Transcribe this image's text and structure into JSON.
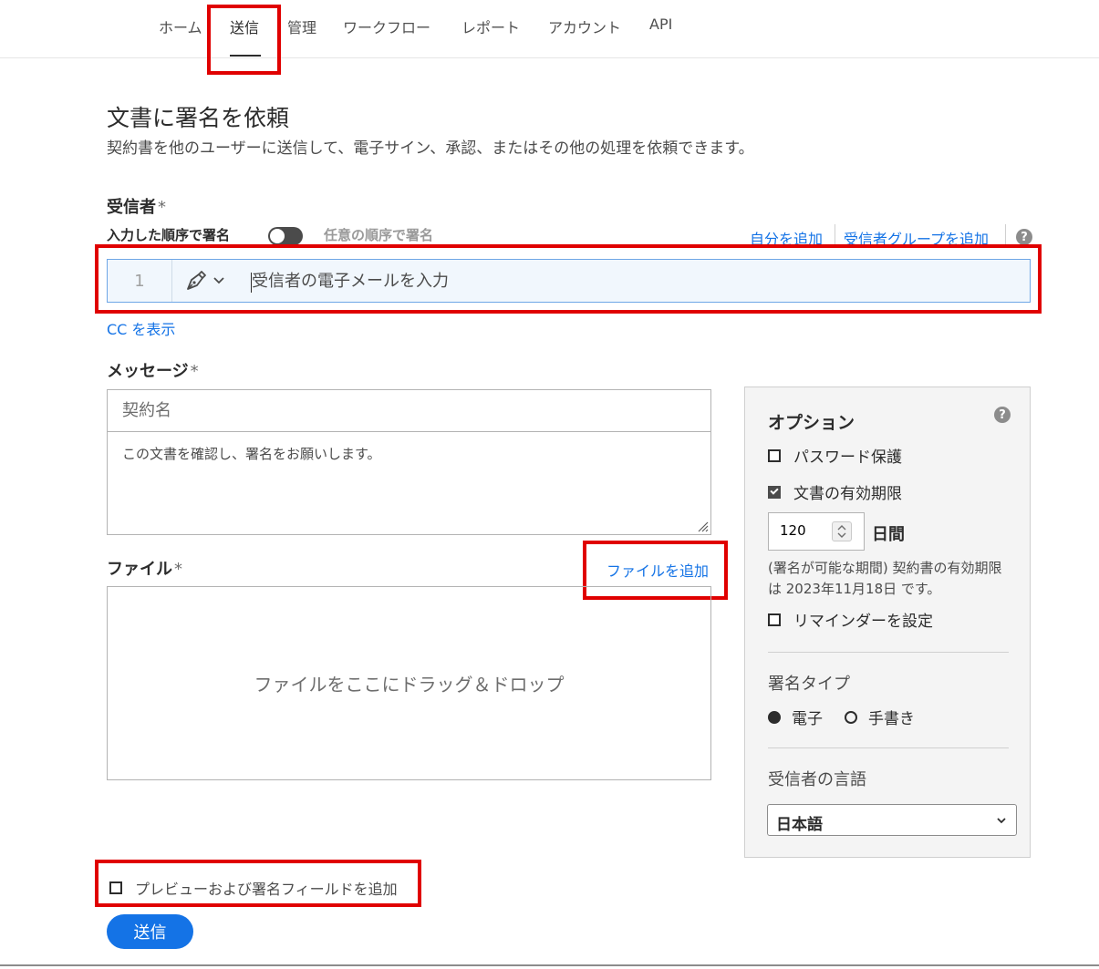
{
  "nav": {
    "items": [
      "ホーム",
      "送信",
      "管理",
      "ワークフロー",
      "レポート",
      "アカウント",
      "API"
    ],
    "active": "送信"
  },
  "page": {
    "title": "文書に署名を依頼",
    "subtitle": "契約書を他のユーザーに送信して、電子サイン、承認、またはその他の処理を依頼できます。"
  },
  "recipients": {
    "label": "受信者",
    "required_mark": "*",
    "order_sequential": "入力した順序で署名",
    "order_any": "任意の順序で署名",
    "add_self": "自分を追加",
    "add_group": "受信者グループを追加",
    "help": "?",
    "row_number": "1",
    "email_placeholder": "受信者の電子メールを入力",
    "show_cc": "CC を表示"
  },
  "message": {
    "label": "メッセージ",
    "required_mark": "*",
    "name_placeholder": "契約名",
    "body": "この文書を確認し、署名をお願いします。"
  },
  "files": {
    "label": "ファイル",
    "required_mark": "*",
    "add_file": "ファイルを追加",
    "drop_text": "ファイルをここにドラッグ＆ドロップ"
  },
  "options": {
    "title": "オプション",
    "help": "?",
    "password_protect": "パスワード保護",
    "password_checked": false,
    "doc_expiry": "文書の有効期限",
    "doc_expiry_checked": true,
    "days_value": "120",
    "days_unit": "日間",
    "expiry_note": "(署名が可能な期間) 契約書の有効期限は 2023年11月18日 です。",
    "set_reminder": "リマインダーを設定",
    "reminder_checked": false,
    "signature_type_label": "署名タイプ",
    "sig_electronic": "電子",
    "sig_handwritten": "手書き",
    "sig_selected": "電子",
    "language_label": "受信者の言語",
    "language_value": "日本語"
  },
  "footer": {
    "preview_label": "プレビューおよび署名フィールドを追加",
    "preview_checked": false,
    "send_button": "送信"
  },
  "colors": {
    "accent": "#1473e6",
    "highlight": "#e00000"
  }
}
